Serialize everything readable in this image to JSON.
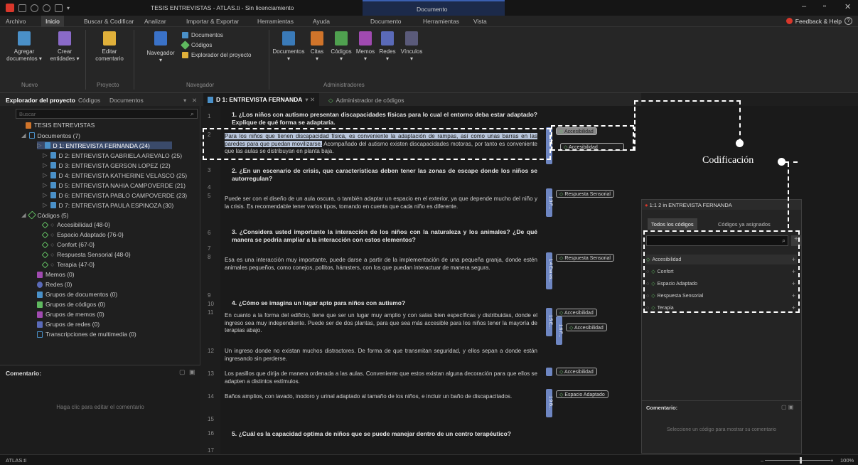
{
  "window": {
    "title": "TESIS ENTREVISTAS - ATLAS.ti - Sin licenciamiento",
    "context_tab": "Documento"
  },
  "menu": {
    "tabs": [
      "Archivo",
      "Inicio",
      "Buscar & Codificar",
      "Analizar",
      "Importar & Exportar",
      "Herramientas",
      "Ayuda",
      "Documento",
      "Herramientas",
      "Vista"
    ],
    "feedback": "Feedback & Help"
  },
  "ribbon": {
    "agregar": "Agregar documentos",
    "crear": "Crear entidades",
    "editar": "Editar comentario",
    "navegador": "Navegador",
    "documentos_small": "Documentos",
    "codigos_small": "Códigos",
    "explorador_small": "Explorador del proyecto",
    "doc_btns": [
      "Documentos",
      "Citas",
      "Códigos",
      "Memos",
      "Redes",
      "Vínculos"
    ],
    "groups": [
      "Nuevo",
      "Proyecto",
      "Navegador",
      "Administradores"
    ]
  },
  "left_panel": {
    "tabs": [
      "Explorador del proyecto",
      "Códigos",
      "Documentos"
    ],
    "search_placeholder": "Buscar",
    "root": "TESIS ENTREVISTAS",
    "documents_header": "Documentos (7)",
    "documents": [
      "D 1: ENTREVISTA FERNANDA (24)",
      "D 2: ENTREVISTA GABRIELA AREVALO (25)",
      "D 3: ENTREVISTA GERSON LOPEZ (22)",
      "D 4: ENTREVISTA KATHERINE VELASCO (25)",
      "D 5: ENTREVISTA NAHIA CAMPOVERDE (21)",
      "D 6: ENTREVISTA PABLO CAMPOVERDE (23)",
      "D 7: ENTREVISTA PAULA ESPINOZA (30)"
    ],
    "codes_header": "Códigos (5)",
    "codes": [
      "Accesibilidad {48-0}",
      "Espacio Adaptado {76-0}",
      "Confort {67-0}",
      "Respuesta Sensorial {48-0}",
      "Terapia {47-0}"
    ],
    "others": [
      "Memos (0)",
      "Redes (0)",
      "Grupos de documentos (0)",
      "Grupos de códigos (0)",
      "Grupos de memos (0)",
      "Grupos de redes (0)",
      "Transcripciones de multimedia (0)"
    ],
    "comment_label": "Comentario:",
    "comment_hint": "Haga clic para editar el comentario"
  },
  "doc_tabs": {
    "active": "D 1: ENTREVISTA FERNANDA",
    "other": "Administrador de códigos"
  },
  "document": {
    "line_numbers": [
      "1",
      "2",
      "3",
      "4",
      "5",
      "6",
      "7",
      "8",
      "9",
      "10",
      "11",
      "12",
      "13",
      "14",
      "15",
      "16",
      "17"
    ],
    "q1": "1.   ¿Los niños con autismo presentan discapacidades físicas para lo cual el entorno deba estar adaptado? Explique de qué forma se adaptaría.",
    "p2_hl": "Para los niños que tienen discapacidad física, es conveniente la adaptación de rampas, así como unas barras en las paredes para que puedan movilizarse.",
    "p2_rest": " Acompañado del autismo existen discapacidades motoras, por tanto es conveniente que las aulas se distribuyan en planta baja.",
    "q2": "2.   ¿En un escenario de crisis, que características deben tener las zonas de escape donde los niños se autorregulan?",
    "p5": "Puede ser con el diseño de un aula oscura, o también adaptar un espacio en el exterior, ya que depende mucho del niño y la crisis. Es recomendable tener varios tipos, tomando en cuenta que cada niño es diferente.",
    "q3": "3.   ¿Considera usted importante la interacción de los niños con la naturaleza y los animales? ¿De qué manera se podría ampliar a la interacción con estos elementos?",
    "p8": "Esa es una interacción muy importante, puede darse a partir de la implementación de una pequeña granja, donde estén animales pequeños, como conejos, pollitos, hámsters, con los que puedan interactuar de manera segura.",
    "q4": "4.   ¿Cómo se imagina un lugar apto para niños con autismo?",
    "p11": "En cuanto a la forma del edificio, tiene que ser un lugar muy amplio y con salas bien específicas y distribuidas, donde el ingreso sea muy independiente. Puede ser de dos plantas, para que sea más accesible para los niños tener la mayoría de terapias abajo.",
    "p12": "Un ingreso donde no existan muchos distractores. De forma de que transmitan seguridad, y ellos sepan a donde están ingresando sin perderse.",
    "p13": "Los pasillos que dirija de manera ordenada a las aulas. Conveniente que estos existan alguna decoración para que ellos se adapten a distintos estímulos.",
    "p14": "Baños amplios, con lavado, inodoro y urinal adaptado al tamaño de los niños, e incluir un baño de discapacitados.",
    "q5": "5.   ¿Cuál es la capacidad optima de niños que se puede manejar dentro de un centro terapéutico?"
  },
  "margin": {
    "bars": [
      "1:1 F...",
      "1:3 F...",
      "1:4 Esa es...",
      "1:5 E...",
      "1:6 F...",
      "",
      "1:9 B..."
    ],
    "labels": [
      "Accesibilidad",
      "Accesibilidad",
      "Respuesta Sensorial",
      "Respuesta Sensorial",
      "Accesibilidad",
      "Accesibilidad",
      "Accesibilidad",
      "Espacio Adaptado"
    ]
  },
  "coding_popup": {
    "title": "1:1 2 in ENTREVISTA FERNANDA",
    "tab_all": "Todos los códigos",
    "tab_assigned": "Códigos ya asignados",
    "codes": [
      "Accesibilidad",
      "Confort",
      "Espacio Adaptado",
      "Respuesta Sensorial",
      "Terapia"
    ],
    "comment_label": "Comentario:",
    "comment_hint": "Seleccione un código para mostrar su comentario"
  },
  "annotation": {
    "label": "Codificación"
  },
  "status": {
    "app": "ATLAS.ti",
    "zoom": "100%"
  },
  "colors": {
    "accent": "#3a5fb0",
    "code_green": "#6fc26f",
    "margin_bar": "#6e86c2",
    "highlight": "#b9c6dc"
  }
}
